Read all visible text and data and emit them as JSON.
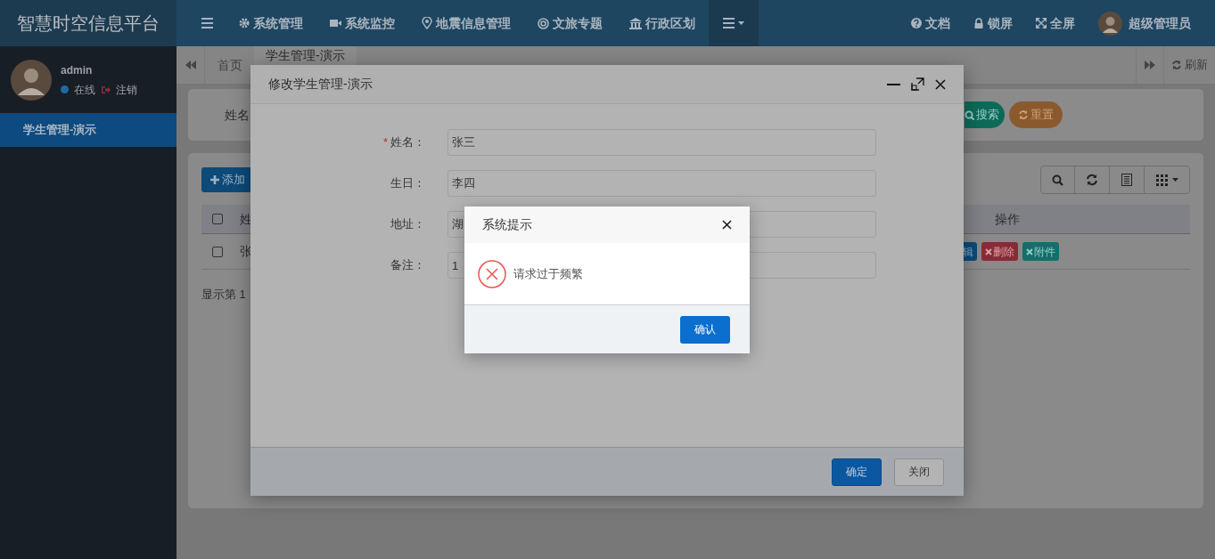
{
  "app_title": "智慧时空信息平台",
  "top_nav": [
    {
      "kind": "toggle",
      "selected": false
    },
    {
      "kind": "gear",
      "label": "系统管理",
      "selected": false
    },
    {
      "kind": "video",
      "label": "系统监控",
      "selected": false
    },
    {
      "kind": "pin",
      "label": "地震信息管理",
      "selected": false
    },
    {
      "kind": "globe",
      "label": "文旅专题",
      "selected": false
    },
    {
      "kind": "bank",
      "label": "行政区划",
      "selected": false
    },
    {
      "kind": "more",
      "selected": true
    }
  ],
  "top_right": [
    {
      "kind": "help",
      "label": "文档"
    },
    {
      "kind": "lock",
      "label": "锁屏"
    },
    {
      "kind": "expand",
      "label": "全屏"
    },
    {
      "kind": "user",
      "label": "超级管理员"
    }
  ],
  "user": {
    "name": "admin",
    "status": "在线",
    "logout": "注销"
  },
  "sidebar": {
    "items": [
      {
        "label": "学生管理-演示",
        "selected": true
      }
    ]
  },
  "tabs": [
    {
      "label": "首页",
      "selected": false
    },
    {
      "label": "学生管理-演示",
      "selected": true
    }
  ],
  "refresh": "刷新",
  "search": {
    "label": "姓名",
    "buttons": [
      {
        "kind": "search",
        "label": "搜索"
      },
      {
        "kind": "reset",
        "label": "重置"
      }
    ]
  },
  "add_button": "添加",
  "table": {
    "header_checked": false,
    "header_first": "姓",
    "header_actions": "操作",
    "rows": [
      {
        "checked": false,
        "cell": "张",
        "actions": [
          {
            "kind": "edit",
            "label": "辑"
          },
          {
            "kind": "delete",
            "label": "删除"
          },
          {
            "kind": "attach",
            "label": "附件"
          }
        ]
      }
    ],
    "footer": "显示第 1"
  },
  "edit_dialog": {
    "title": "修改学生管理-演示",
    "fields": [
      {
        "mark": "*",
        "label": "姓名：",
        "value": "张三"
      },
      {
        "label": "生日：",
        "value": "李四"
      },
      {
        "label": "地址：",
        "value": "湖"
      },
      {
        "label": "备注：",
        "value": "1"
      }
    ],
    "buttons": [
      {
        "kind": "primary",
        "label": "确定"
      },
      {
        "kind": "default",
        "label": "关闭"
      }
    ]
  },
  "alert": {
    "title": "系统提示",
    "message": "请求过于频繁",
    "confirm": "确认"
  }
}
